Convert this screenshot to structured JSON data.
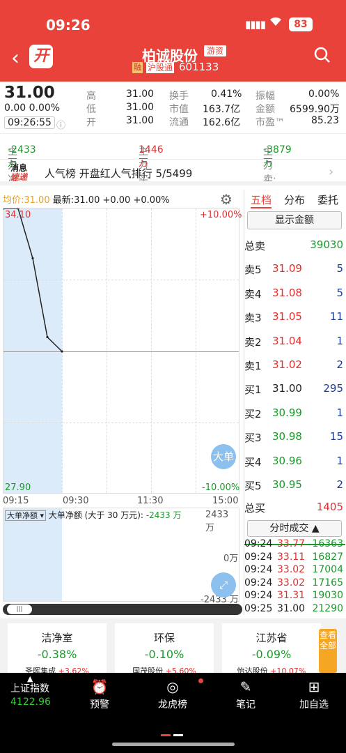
{
  "status": {
    "time": "09:26",
    "signal": "▮▮▮▮",
    "battery": "83"
  },
  "header": {
    "logo": "开",
    "name": "柏诚股份",
    "tag": "游资",
    "rong": "融",
    "hgt": "沪股通",
    "code": "601133"
  },
  "quote": {
    "price": "31.00",
    "change": "0.00",
    "change_pct": "0.00%",
    "time": "09:26:55",
    "high_label": "高",
    "high": "31.00",
    "low_label": "低",
    "low": "31.00",
    "open_label": "开",
    "open": "31.00",
    "turnover_label": "换手",
    "turnover": "0.41%",
    "mcap_label": "市值",
    "mcap": "163.7亿",
    "float_label": "流通",
    "float": "162.6亿",
    "amp_label": "振幅",
    "amp": "0.00%",
    "amount_label": "金额",
    "amount": "6599.90万",
    "pe_label": "市盈™",
    "pe": "85.23"
  },
  "flows": {
    "net_label": "主力净:",
    "net": "-2433万",
    "buy_label": "主力买:",
    "buy": "1446万",
    "sell_label": "主力卖:",
    "sell": "-3879万"
  },
  "news": {
    "badge_top": "消息",
    "badge_bottom": "速递",
    "text": "人气榜   开盘红人气排行 5/5499"
  },
  "chart": {
    "avg_label": "均价:31.00",
    "latest_label": "最新:31.00 +0.00 +0.00%",
    "ymax": "34.10",
    "ymin": "27.90",
    "pmax": "+10.00%",
    "pmin": "-10.00%",
    "x_ticks": [
      "09:15",
      "09:30",
      "11:30",
      "15:00"
    ],
    "big_btn": "大单",
    "sub_dropdown": "大单净额 ▾",
    "sub_title": "大单净额 (大于 30 万元):",
    "sub_value": "-2433 万",
    "sub_ymax": "2433 万",
    "sub_mid": "0万",
    "sub_ymin": "-2433 万"
  },
  "chart_data": {
    "type": "line",
    "title": "",
    "x": [
      "09:15",
      "09:20",
      "09:25",
      "09:25",
      "09:26"
    ],
    "series": [
      {
        "values": [
          34.1,
          34.1,
          33.02,
          31.31,
          31.0
        ]
      }
    ],
    "ylim": [
      27.9,
      34.1
    ],
    "y2lim": [
      "-10.00%",
      "+10.00%"
    ]
  },
  "book": {
    "tabs": [
      "五档",
      "分布",
      "委托"
    ],
    "show_amount": "显示金额",
    "total_sell_label": "总卖",
    "total_sell": "39030",
    "asks": [
      {
        "label": "卖5",
        "price": "31.09",
        "vol": "5"
      },
      {
        "label": "卖4",
        "price": "31.08",
        "vol": "5"
      },
      {
        "label": "卖3",
        "price": "31.05",
        "vol": "11"
      },
      {
        "label": "卖2",
        "price": "31.04",
        "vol": "1"
      },
      {
        "label": "卖1",
        "price": "31.02",
        "vol": "2"
      }
    ],
    "bids": [
      {
        "label": "买1",
        "price": "31.00",
        "vol": "295"
      },
      {
        "label": "买2",
        "price": "30.99",
        "vol": "1"
      },
      {
        "label": "买3",
        "price": "30.98",
        "vol": "15"
      },
      {
        "label": "买4",
        "price": "30.96",
        "vol": "1"
      },
      {
        "label": "买5",
        "price": "30.95",
        "vol": "2"
      }
    ],
    "total_buy_label": "总买",
    "total_buy": "1405",
    "trades_header": "分时成交 ▲",
    "trades": [
      {
        "t": "09:24",
        "p": "33.77",
        "v": "16363"
      },
      {
        "t": "09:24",
        "p": "33.11",
        "v": "16827"
      },
      {
        "t": "09:24",
        "p": "33.02",
        "v": "17004"
      },
      {
        "t": "09:24",
        "p": "33.02",
        "v": "17165"
      },
      {
        "t": "09:24",
        "p": "31.31",
        "v": "19030"
      },
      {
        "t": "09:25",
        "p": "31.00",
        "v": "21290"
      }
    ]
  },
  "sectors": [
    {
      "name": "洁净室",
      "pct": "-0.38%",
      "stock": "圣晖集成",
      "stock_pct": "+3.62%"
    },
    {
      "name": "环保",
      "pct": "-0.10%",
      "stock": "国茂股份",
      "stock_pct": "+5.60%"
    },
    {
      "name": "江苏省",
      "pct": "-0.09%",
      "stock": "怡达股份",
      "stock_pct": "+10.07%"
    }
  ],
  "view_all": "查看全部",
  "bottom": {
    "index_label": "上证指数",
    "index_value": "4122.96",
    "items": [
      "预警",
      "龙虎榜",
      "笔记",
      "加自选"
    ]
  },
  "colors": {
    "brand": "#e8423a",
    "up": "#e03030",
    "down": "#1a9a2a"
  }
}
